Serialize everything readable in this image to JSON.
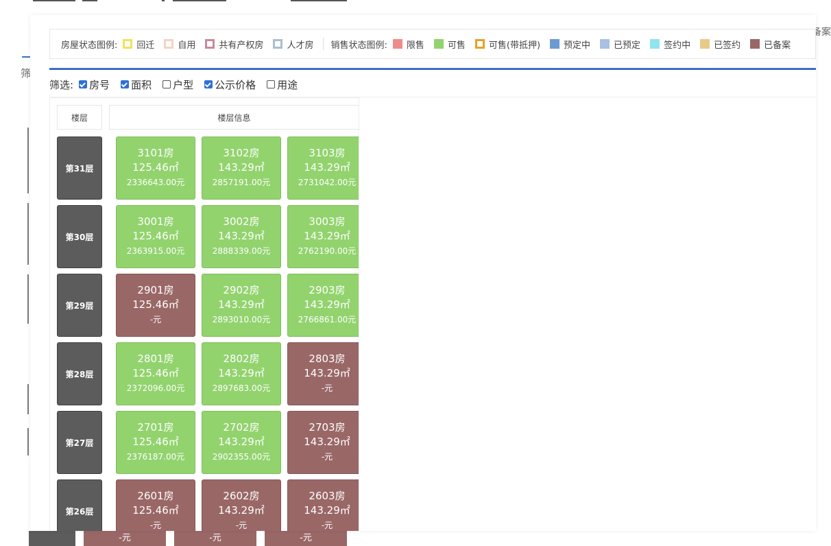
{
  "background": {
    "bottom_cells": [
      "-元",
      "-元",
      "-元"
    ],
    "right_text": "备案",
    "left_text": "筛"
  },
  "legend": {
    "house_status_title": "房屋状态图例:",
    "house_status": [
      {
        "label": "回迁",
        "color": "#f2e15a",
        "style": "outline"
      },
      {
        "label": "自用",
        "color": "#f4d3c2",
        "style": "outline"
      },
      {
        "label": "共有产权房",
        "color": "#c98a9a",
        "style": "outline"
      },
      {
        "label": "人才房",
        "color": "#a9bfcf",
        "style": "outline"
      }
    ],
    "sale_status_title": "销售状态图例:",
    "sale_status": [
      {
        "label": "限售",
        "color": "#f08b8b",
        "style": "fill"
      },
      {
        "label": "可售",
        "color": "#92d36e",
        "style": "fill"
      },
      {
        "label": "可售(带抵押)",
        "color": "#e8a126",
        "style": "outline"
      },
      {
        "label": "预定中",
        "color": "#6b9bd1",
        "style": "fill"
      },
      {
        "label": "已预定",
        "color": "#a8c1e0",
        "style": "fill"
      },
      {
        "label": "签约中",
        "color": "#8fe4ef",
        "style": "fill"
      },
      {
        "label": "已签约",
        "color": "#e9c98a",
        "style": "fill"
      },
      {
        "label": "已备案",
        "color": "#9a6767",
        "style": "fill"
      }
    ]
  },
  "filters": {
    "label": "筛选:",
    "options": [
      {
        "label": "房号",
        "checked": true
      },
      {
        "label": "面积",
        "checked": true
      },
      {
        "label": "户型",
        "checked": false
      },
      {
        "label": "公示价格",
        "checked": true
      },
      {
        "label": "用途",
        "checked": false
      }
    ]
  },
  "table": {
    "header_floor": "楼层",
    "header_info": "楼层信息",
    "floors": [
      {
        "floor": "第31层",
        "units": [
          {
            "room": "3101房",
            "area": "125.46㎡",
            "price": "2336643.00元",
            "status": "sale"
          },
          {
            "room": "3102房",
            "area": "143.29㎡",
            "price": "2857191.00元",
            "status": "sale"
          },
          {
            "room": "3103房",
            "area": "143.29㎡",
            "price": "2731042.00元",
            "status": "sale"
          }
        ]
      },
      {
        "floor": "第30层",
        "units": [
          {
            "room": "3001房",
            "area": "125.46㎡",
            "price": "2363915.00元",
            "status": "sale"
          },
          {
            "room": "3002房",
            "area": "143.29㎡",
            "price": "2888339.00元",
            "status": "sale"
          },
          {
            "room": "3003房",
            "area": "143.29㎡",
            "price": "2762190.00元",
            "status": "sale"
          }
        ]
      },
      {
        "floor": "第29层",
        "units": [
          {
            "room": "2901房",
            "area": "125.46㎡",
            "price": "-元",
            "status": "filed"
          },
          {
            "room": "2902房",
            "area": "143.29㎡",
            "price": "2893010.00元",
            "status": "sale"
          },
          {
            "room": "2903房",
            "area": "143.29㎡",
            "price": "2766861.00元",
            "status": "sale"
          }
        ]
      },
      {
        "floor": "第28层",
        "units": [
          {
            "room": "2801房",
            "area": "125.46㎡",
            "price": "2372096.00元",
            "status": "sale"
          },
          {
            "room": "2802房",
            "area": "143.29㎡",
            "price": "2897683.00元",
            "status": "sale"
          },
          {
            "room": "2803房",
            "area": "143.29㎡",
            "price": "-元",
            "status": "filed"
          }
        ]
      },
      {
        "floor": "第27层",
        "units": [
          {
            "room": "2701房",
            "area": "125.46㎡",
            "price": "2376187.00元",
            "status": "sale"
          },
          {
            "room": "2702房",
            "area": "143.29㎡",
            "price": "2902355.00元",
            "status": "sale"
          },
          {
            "room": "2703房",
            "area": "143.29㎡",
            "price": "-元",
            "status": "filed"
          }
        ]
      },
      {
        "floor": "第26层",
        "units": [
          {
            "room": "2601房",
            "area": "125.46㎡",
            "price": "-元",
            "status": "filed"
          },
          {
            "room": "2602房",
            "area": "143.29㎡",
            "price": "-元",
            "status": "filed"
          },
          {
            "room": "2603房",
            "area": "143.29㎡",
            "price": "-元",
            "status": "filed"
          }
        ]
      }
    ]
  }
}
